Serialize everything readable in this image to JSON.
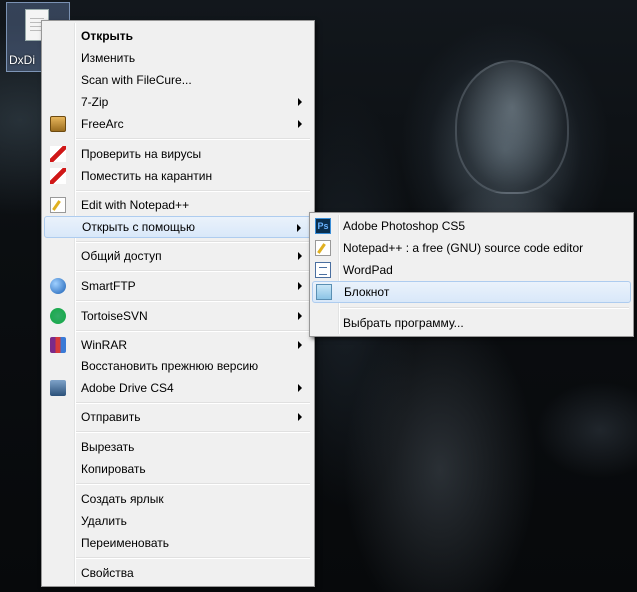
{
  "desktop": {
    "icon_label": "DxDi"
  },
  "context_menu": {
    "items": [
      {
        "label": "Открыть",
        "bold": true
      },
      {
        "label": "Изменить"
      },
      {
        "label": "Scan with FileCure..."
      },
      {
        "label": "7-Zip",
        "submenu": true
      },
      {
        "label": "FreeArc",
        "submenu": true,
        "icon": "freearc-icon"
      },
      {
        "label": "Проверить на вирусы",
        "icon": "kaspersky-icon"
      },
      {
        "label": "Поместить на карантин",
        "icon": "kaspersky-icon"
      },
      {
        "label": "Edit with Notepad++",
        "icon": "notepadpp-icon"
      },
      {
        "label": "Открыть с помощью",
        "submenu": true,
        "highlighted": true
      },
      {
        "label": "Общий доступ",
        "submenu": true
      },
      {
        "label": "SmartFTP",
        "submenu": true,
        "icon": "smartftp-icon"
      },
      {
        "label": "TortoiseSVN",
        "submenu": true,
        "icon": "tortoisesvn-icon"
      },
      {
        "label": "WinRAR",
        "submenu": true,
        "icon": "winrar-icon"
      },
      {
        "label": "Восстановить прежнюю версию"
      },
      {
        "label": "Adobe Drive CS4",
        "submenu": true,
        "icon": "adobe-drive-icon"
      },
      {
        "label": "Отправить",
        "submenu": true
      },
      {
        "label": "Вырезать"
      },
      {
        "label": "Копировать"
      },
      {
        "label": "Создать ярлык"
      },
      {
        "label": "Удалить"
      },
      {
        "label": "Переименовать"
      },
      {
        "label": "Свойства"
      }
    ]
  },
  "open_with_submenu": {
    "items": [
      {
        "label": "Adobe Photoshop CS5",
        "icon": "photoshop-icon",
        "icon_text": "Ps"
      },
      {
        "label": "Notepad++ : a free (GNU) source code editor",
        "icon": "notepadpp-icon"
      },
      {
        "label": "WordPad",
        "icon": "wordpad-icon"
      },
      {
        "label": "Блокнот",
        "icon": "notepad-icon",
        "highlighted": true
      },
      {
        "label": "Выбрать программу..."
      }
    ]
  }
}
